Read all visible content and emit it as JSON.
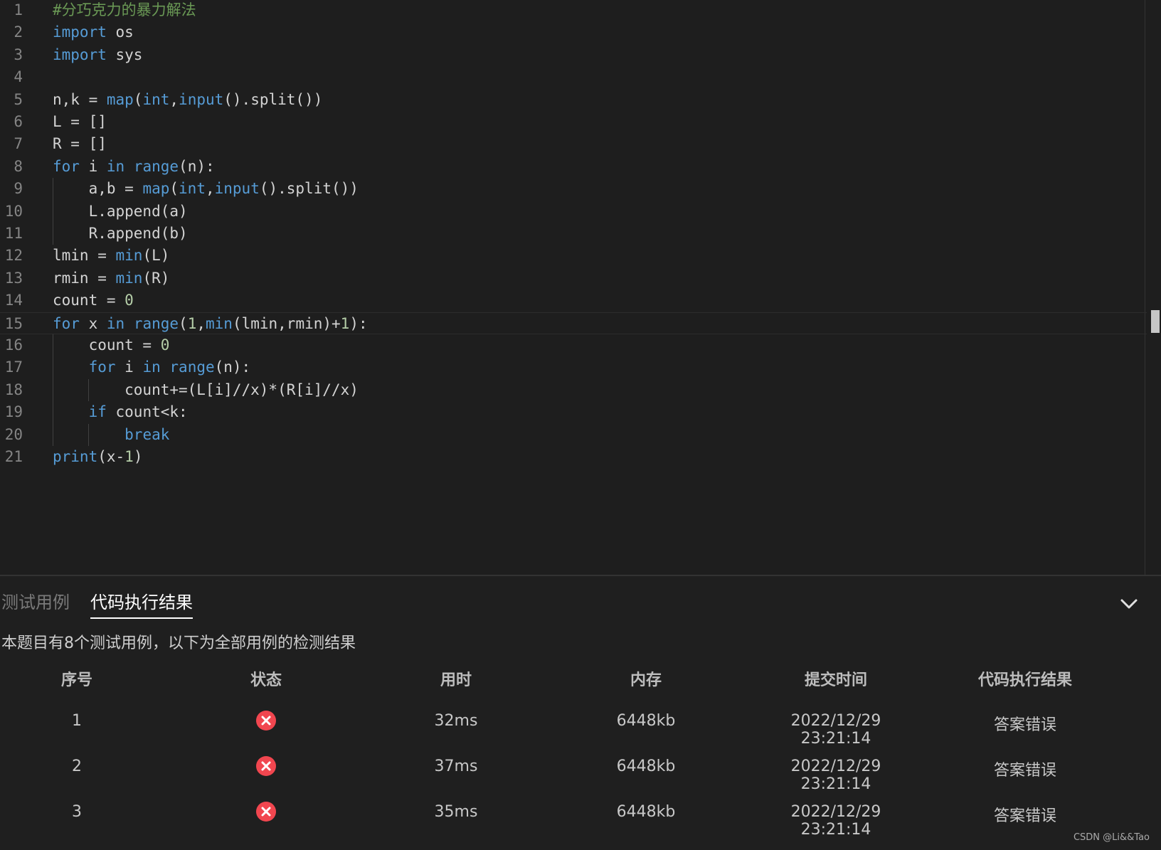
{
  "editor": {
    "lines": [
      "#分巧克力的暴力解法",
      "import os",
      "import sys",
      "",
      "n,k = map(int,input().split())",
      "L = []",
      "R = []",
      "for i in range(n):",
      "    a,b = map(int,input().split())",
      "    L.append(a)",
      "    R.append(b)",
      "lmin = min(L)",
      "rmin = min(R)",
      "count = 0",
      "for x in range(1,min(lmin,rmin)+1):",
      "    count = 0",
      "    for i in range(n):",
      "        count+=(L[i]//x)*(R[i]//x)",
      "    if count<k:",
      "        break",
      "print(x-1)"
    ],
    "current_line": 15
  },
  "panel": {
    "tabs": [
      "测试用例",
      "代码执行结果"
    ],
    "active_tab": "代码执行结果",
    "summary": "本题目有8个测试用例，以下为全部用例的检测结果",
    "columns": [
      "序号",
      "状态",
      "用时",
      "内存",
      "提交时间",
      "代码执行结果"
    ],
    "rows": [
      {
        "index": "1",
        "status": "error",
        "time": "32ms",
        "memory": "6448kb",
        "submitted": "2022/12/29 23:21:14",
        "result": "答案错误"
      },
      {
        "index": "2",
        "status": "error",
        "time": "37ms",
        "memory": "6448kb",
        "submitted": "2022/12/29 23:21:14",
        "result": "答案错误"
      },
      {
        "index": "3",
        "status": "error",
        "time": "35ms",
        "memory": "6448kb",
        "submitted": "2022/12/29 23:21:14",
        "result": "答案错误"
      }
    ]
  },
  "icons": {
    "status_error": "close-circle-icon",
    "collapse": "chevron-down-icon"
  },
  "colors": {
    "keyword": "#569cd6",
    "comment": "#6a9955",
    "number": "#b5cea8",
    "error_red": "#f1464f"
  },
  "watermark": "CSDN @Li&&Tao"
}
